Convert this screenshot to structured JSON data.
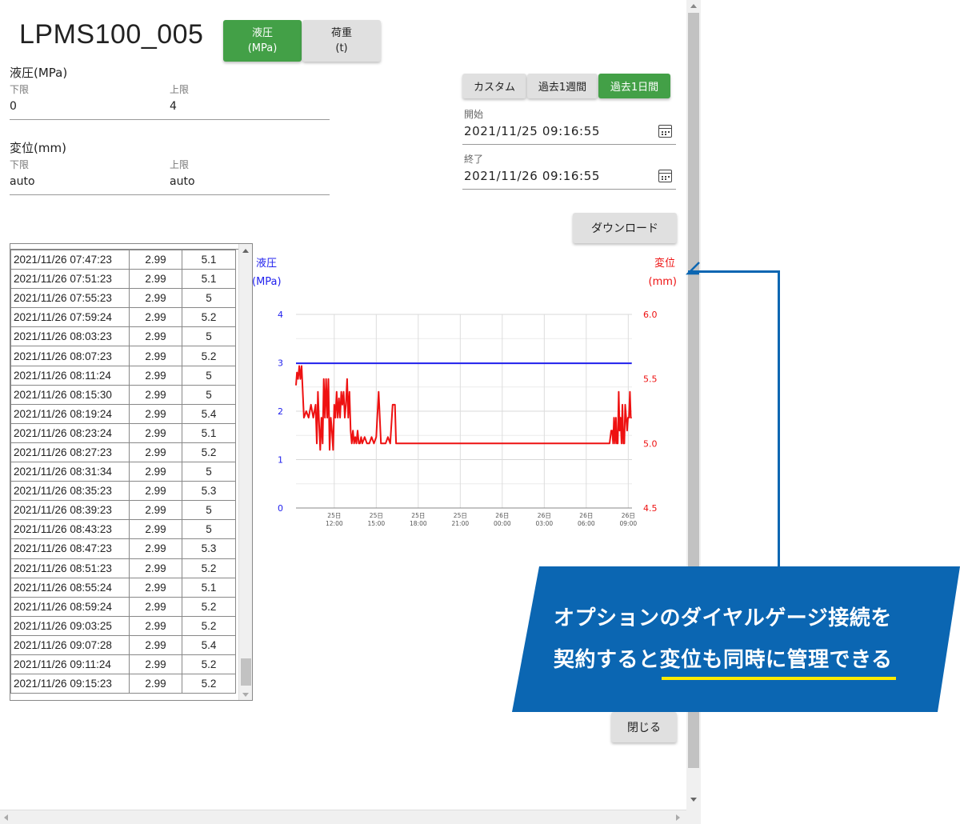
{
  "header": {
    "title": "LPMS100_005",
    "modes": [
      {
        "line1": "液圧",
        "line2": "(MPa)",
        "active": true
      },
      {
        "line1": "荷重",
        "line2": "(t)",
        "active": false
      }
    ]
  },
  "ranges": [
    {
      "title": "液圧(MPa)",
      "lower_label": "下限",
      "lower_value": "0",
      "upper_label": "上限",
      "upper_value": "4"
    },
    {
      "title": "変位(mm)",
      "lower_label": "下限",
      "lower_value": "auto",
      "upper_label": "上限",
      "upper_value": "auto"
    }
  ],
  "period": {
    "buttons": [
      {
        "label": "カスタム",
        "active": false
      },
      {
        "label": "過去1週間",
        "active": false
      },
      {
        "label": "過去1日間",
        "active": true
      }
    ],
    "start_label": "開始",
    "start_value": "2021/11/25 09:16:55",
    "end_label": "終了",
    "end_value": "2021/11/26 09:16:55"
  },
  "download_label": "ダウンロード",
  "close_label": "閉じる",
  "table": {
    "rows": [
      [
        "2021/11/26 07:47:23",
        "2.99",
        "5.1"
      ],
      [
        "2021/11/26 07:51:23",
        "2.99",
        "5.1"
      ],
      [
        "2021/11/26 07:55:23",
        "2.99",
        "5"
      ],
      [
        "2021/11/26 07:59:24",
        "2.99",
        "5.2"
      ],
      [
        "2021/11/26 08:03:23",
        "2.99",
        "5"
      ],
      [
        "2021/11/26 08:07:23",
        "2.99",
        "5.2"
      ],
      [
        "2021/11/26 08:11:24",
        "2.99",
        "5"
      ],
      [
        "2021/11/26 08:15:30",
        "2.99",
        "5"
      ],
      [
        "2021/11/26 08:19:24",
        "2.99",
        "5.4"
      ],
      [
        "2021/11/26 08:23:24",
        "2.99",
        "5.1"
      ],
      [
        "2021/11/26 08:27:23",
        "2.99",
        "5.2"
      ],
      [
        "2021/11/26 08:31:34",
        "2.99",
        "5"
      ],
      [
        "2021/11/26 08:35:23",
        "2.99",
        "5.3"
      ],
      [
        "2021/11/26 08:39:23",
        "2.99",
        "5"
      ],
      [
        "2021/11/26 08:43:23",
        "2.99",
        "5"
      ],
      [
        "2021/11/26 08:47:23",
        "2.99",
        "5.3"
      ],
      [
        "2021/11/26 08:51:23",
        "2.99",
        "5.2"
      ],
      [
        "2021/11/26 08:55:24",
        "2.99",
        "5.1"
      ],
      [
        "2021/11/26 08:59:24",
        "2.99",
        "5.2"
      ],
      [
        "2021/11/26 09:03:25",
        "2.99",
        "5.2"
      ],
      [
        "2021/11/26 09:07:28",
        "2.99",
        "5.4"
      ],
      [
        "2021/11/26 09:11:24",
        "2.99",
        "5.2"
      ],
      [
        "2021/11/26 09:15:23",
        "2.99",
        "5.2"
      ]
    ]
  },
  "chart_data": {
    "type": "line",
    "left_axis": {
      "label_line1": "液圧",
      "label_line2": "(MPa)",
      "ylim": [
        0,
        4
      ],
      "ticks": [
        "0",
        "1",
        "2",
        "3",
        "4"
      ],
      "color": "#2222ee"
    },
    "right_axis": {
      "label_line1": "変位",
      "label_line2": "(mm)",
      "ylim": [
        4.5,
        6.0
      ],
      "ticks": [
        "4.5",
        "5.0",
        "5.5",
        "6.0"
      ],
      "color": "#ee1111"
    },
    "xlim": [
      "2021-11-25 09:16",
      "2021-11-26 09:16"
    ],
    "x_ticks": [
      {
        "date": "25日",
        "time": "12:00"
      },
      {
        "date": "25日",
        "time": "15:00"
      },
      {
        "date": "25日",
        "time": "18:00"
      },
      {
        "date": "25日",
        "time": "21:00"
      },
      {
        "date": "26日",
        "time": "00:00"
      },
      {
        "date": "26日",
        "time": "03:00"
      },
      {
        "date": "26日",
        "time": "06:00"
      },
      {
        "date": "26日",
        "time": "09:00"
      }
    ],
    "grid": true,
    "series": [
      {
        "axis": "left",
        "color": "#2222ee",
        "x": [
          "2021-11-25 09:16",
          "2021-11-25 12:00",
          "2021-11-25 18:00",
          "2021-11-26 00:00",
          "2021-11-26 06:00",
          "2021-11-26 09:15"
        ],
        "y": [
          2.99,
          2.99,
          2.99,
          2.99,
          2.99,
          2.99
        ]
      },
      {
        "axis": "right",
        "color": "#ee1111",
        "x": [
          "2021-11-25 09:16",
          "2021-11-25 09:20",
          "2021-11-25 09:25",
          "2021-11-25 09:30",
          "2021-11-25 09:35",
          "2021-11-25 09:40",
          "2021-11-25 09:50",
          "2021-11-25 10:00",
          "2021-11-25 10:10",
          "2021-11-25 10:20",
          "2021-11-25 10:30",
          "2021-11-25 10:40",
          "2021-11-25 10:45",
          "2021-11-25 10:50",
          "2021-11-25 10:55",
          "2021-11-25 11:00",
          "2021-11-25 11:05",
          "2021-11-25 11:10",
          "2021-11-25 11:15",
          "2021-11-25 11:20",
          "2021-11-25 11:25",
          "2021-11-25 11:30",
          "2021-11-25 11:35",
          "2021-11-25 11:40",
          "2021-11-25 11:45",
          "2021-11-25 11:50",
          "2021-11-25 11:55",
          "2021-11-25 12:00",
          "2021-11-25 12:05",
          "2021-11-25 12:10",
          "2021-11-25 12:15",
          "2021-11-25 12:20",
          "2021-11-25 12:25",
          "2021-11-25 12:30",
          "2021-11-25 12:35",
          "2021-11-25 12:40",
          "2021-11-25 12:45",
          "2021-11-25 12:50",
          "2021-11-25 12:55",
          "2021-11-25 13:00",
          "2021-11-25 13:05",
          "2021-11-25 13:10",
          "2021-11-25 13:15",
          "2021-11-25 13:20",
          "2021-11-25 13:25",
          "2021-11-25 13:30",
          "2021-11-25 13:35",
          "2021-11-25 13:40",
          "2021-11-25 13:45",
          "2021-11-25 13:50",
          "2021-11-25 13:55",
          "2021-11-25 14:00",
          "2021-11-25 14:10",
          "2021-11-25 14:20",
          "2021-11-25 14:30",
          "2021-11-25 14:40",
          "2021-11-25 14:50",
          "2021-11-25 15:00",
          "2021-11-25 15:10",
          "2021-11-25 15:20",
          "2021-11-25 15:30",
          "2021-11-25 15:40",
          "2021-11-25 15:50",
          "2021-11-25 16:00",
          "2021-11-25 16:10",
          "2021-11-25 16:20",
          "2021-11-25 16:25",
          "2021-11-25 16:30",
          "2021-11-25 16:35",
          "2021-11-25 16:40",
          "2021-11-25 16:45",
          "2021-11-25 16:50",
          "2021-11-25 17:00",
          "2021-11-25 17:10",
          "2021-11-25 17:20",
          "2021-11-26 07:00",
          "2021-11-26 07:10",
          "2021-11-26 07:20",
          "2021-11-26 07:30",
          "2021-11-26 07:40",
          "2021-11-26 07:47",
          "2021-11-26 07:51",
          "2021-11-26 07:55",
          "2021-11-26 07:59",
          "2021-11-26 08:03",
          "2021-11-26 08:07",
          "2021-11-26 08:11",
          "2021-11-26 08:15",
          "2021-11-26 08:19",
          "2021-11-26 08:23",
          "2021-11-26 08:27",
          "2021-11-26 08:31",
          "2021-11-26 08:35",
          "2021-11-26 08:39",
          "2021-11-26 08:43",
          "2021-11-26 08:47",
          "2021-11-26 08:51",
          "2021-11-26 08:55",
          "2021-11-26 08:59",
          "2021-11-26 09:03",
          "2021-11-26 09:07",
          "2021-11-26 09:11",
          "2021-11-26 09:15"
        ],
        "y": [
          5.45,
          5.55,
          5.5,
          5.6,
          5.5,
          5.6,
          5.2,
          5.25,
          5.2,
          5.3,
          5.2,
          5.3,
          5.0,
          5.4,
          5.15,
          4.95,
          5.2,
          5.0,
          5.5,
          5.2,
          5.5,
          5.2,
          5.5,
          4.95,
          5.2,
          5.1,
          4.95,
          5.3,
          5.2,
          5.4,
          5.2,
          5.35,
          5.2,
          5.4,
          5.3,
          5.4,
          5.2,
          5.3,
          5.5,
          5.2,
          5.4,
          5.1,
          5.0,
          5.1,
          5.0,
          5.05,
          5.0,
          5.1,
          5.0,
          5.0,
          5.05,
          5.0,
          5.05,
          5.0,
          5.0,
          5.05,
          5.0,
          5.05,
          5.4,
          5.0,
          5.0,
          5.0,
          5.05,
          5.0,
          5.3,
          5.3,
          5.0,
          5.0,
          5.0,
          5.0,
          5.0,
          5.0,
          5.0,
          5.0,
          5.0,
          5.0,
          5.0,
          5.0,
          5.0,
          5.0,
          5.1,
          5.1,
          5.0,
          5.2,
          5.0,
          5.2,
          5.0,
          5.0,
          5.4,
          5.1,
          5.2,
          5.0,
          5.3,
          5.0,
          5.0,
          5.3,
          5.2,
          5.1,
          5.2,
          5.2,
          5.4,
          5.2,
          5.2
        ]
      }
    ]
  },
  "callout": {
    "line1": "オプションのダイヤルゲージ接続を",
    "line2_pre": "契約すると",
    "line2_highlight": "変位も同時に管理できる"
  },
  "colors": {
    "accent_green": "#43a047",
    "callout_blue": "#0b66b2",
    "highlight_yellow": "#ffeb00",
    "series_blue": "#2222ee",
    "series_red": "#ee1111"
  }
}
